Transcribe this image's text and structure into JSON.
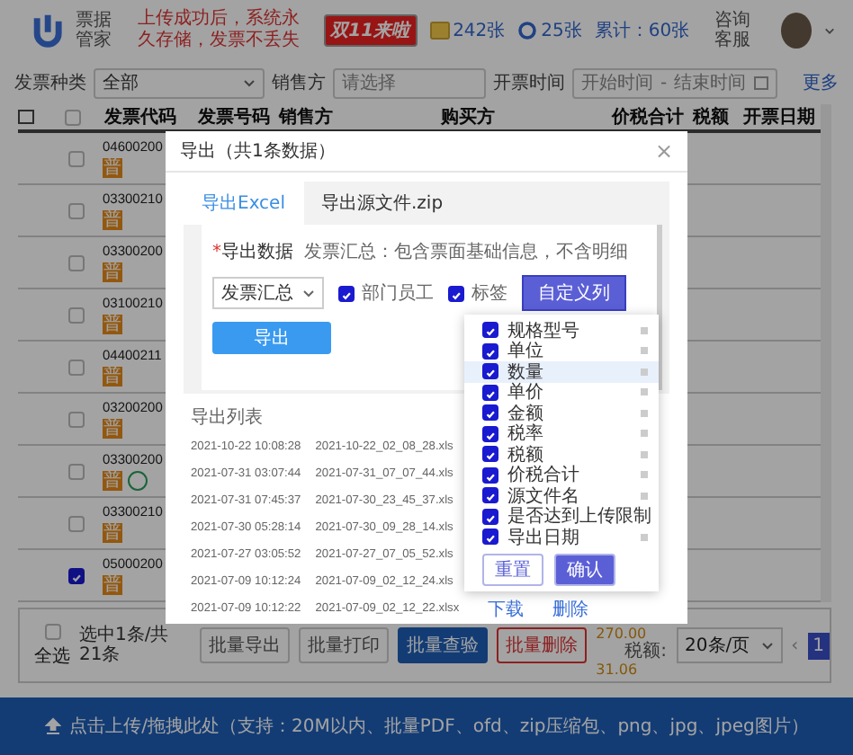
{
  "header": {
    "app_name": "票据管家",
    "notice": "上传成功后，系统永久存储，发票不丢失",
    "promo_badge": "双11来啦",
    "invoice_count": "242张",
    "check_count": "25张",
    "total_count": "累计：60张",
    "support": "咨询客服"
  },
  "filters": [
    {
      "kind": "select",
      "label": "发票种类",
      "value": "全部"
    },
    {
      "kind": "input",
      "label": "销售方",
      "placeholder": "请选择"
    },
    {
      "kind": "range",
      "label": "开票时间",
      "start_placeholder": "开始时间",
      "separator": "-",
      "end_placeholder": "结束时间"
    }
  ],
  "more_link": "更多",
  "table": {
    "header_checked": false,
    "columns": [
      "发票代码",
      "发票号码",
      "销售方",
      "购买方",
      "价税合计",
      "税额",
      "开票日期"
    ],
    "rows": [
      {
        "code": "04600200",
        "badge": "普",
        "selected": false,
        "verified": false
      },
      {
        "code": "03300210",
        "badge": "普",
        "selected": false,
        "verified": false
      },
      {
        "code": "03300200",
        "badge": "普",
        "selected": false,
        "verified": false
      },
      {
        "code": "03100210",
        "badge": "普",
        "selected": false,
        "verified": false
      },
      {
        "code": "04400211",
        "badge": "普",
        "selected": false,
        "verified": false
      },
      {
        "code": "03200200",
        "badge": "普",
        "selected": false,
        "verified": false
      },
      {
        "code": "03300200",
        "badge": "普",
        "selected": false,
        "verified": true
      },
      {
        "code": "03300210",
        "badge": "普",
        "selected": false,
        "verified": false
      },
      {
        "code": "05000200",
        "badge": "普",
        "selected": true,
        "verified": false
      }
    ]
  },
  "footer": {
    "select_all": {
      "label": "全选",
      "checked": false
    },
    "selection": "选中1条/共21条",
    "buttons": [
      {
        "label": "批量导出",
        "kind": "default"
      },
      {
        "label": "批量打印",
        "kind": "default"
      },
      {
        "label": "批量查验",
        "kind": "primary"
      },
      {
        "label": "批量删除",
        "kind": "danger"
      }
    ],
    "amount_value": "270.00",
    "tax_label": "税额:",
    "tax_value": "31.06",
    "page_size": "20条/页",
    "prev": "‹",
    "page": "1"
  },
  "upload": {
    "text": "点击上传/拖拽此处（支持：20M以内、批量PDF、ofd、zip压缩包、png、jpg、jpeg图片）"
  },
  "modal": {
    "title": "导出（共1条数据）",
    "close": "×",
    "tabs": [
      {
        "label": "导出Excel",
        "selected": true
      },
      {
        "label": "导出源文件.zip",
        "selected": false
      }
    ],
    "required_mark": "*",
    "field_label": "导出数据",
    "description": "发票汇总：包含票面基础信息，不含明细",
    "select_value": "发票汇总",
    "options": [
      {
        "label": "部门员工",
        "checked": true
      },
      {
        "label": "标签",
        "checked": true
      }
    ],
    "custom_button": "自定义列",
    "export_button": "导出",
    "list_title": "导出列表",
    "exports": [
      {
        "time": "2021-10-22 10:08:28",
        "file": "2021-10-22_02_08_28.xls"
      },
      {
        "time": "2021-07-31 03:07:44",
        "file": "2021-07-31_07_07_44.xls"
      },
      {
        "time": "2021-07-31 07:45:37",
        "file": "2021-07-30_23_45_37.xls"
      },
      {
        "time": "2021-07-30 05:28:14",
        "file": "2021-07-30_09_28_14.xls"
      },
      {
        "time": "2021-07-27 03:05:52",
        "file": "2021-07-27_07_05_52.xls"
      },
      {
        "time": "2021-07-09 10:12:24",
        "file": "2021-07-09_02_12_24.xls"
      },
      {
        "time": "2021-07-09 10:12:22",
        "file": "2021-07-09_02_12_22.xlsx"
      }
    ],
    "actions": [
      "下载",
      "删除"
    ]
  },
  "column_menu": {
    "items": [
      {
        "label": "规格型号",
        "checked": true,
        "selected": false
      },
      {
        "label": "单位",
        "checked": true,
        "selected": false
      },
      {
        "label": "数量",
        "checked": true,
        "selected": true
      },
      {
        "label": "单价",
        "checked": true,
        "selected": false
      },
      {
        "label": "金额",
        "checked": true,
        "selected": false
      },
      {
        "label": "税率",
        "checked": true,
        "selected": false
      },
      {
        "label": "税额",
        "checked": true,
        "selected": false
      },
      {
        "label": "价税合计",
        "checked": true,
        "selected": false
      },
      {
        "label": "源文件名",
        "checked": true,
        "selected": false
      },
      {
        "label": "是否达到上传限制",
        "checked": true,
        "selected": false
      },
      {
        "label": "导出日期",
        "checked": true,
        "selected": false
      }
    ],
    "reset": "重置",
    "confirm": "确认"
  }
}
